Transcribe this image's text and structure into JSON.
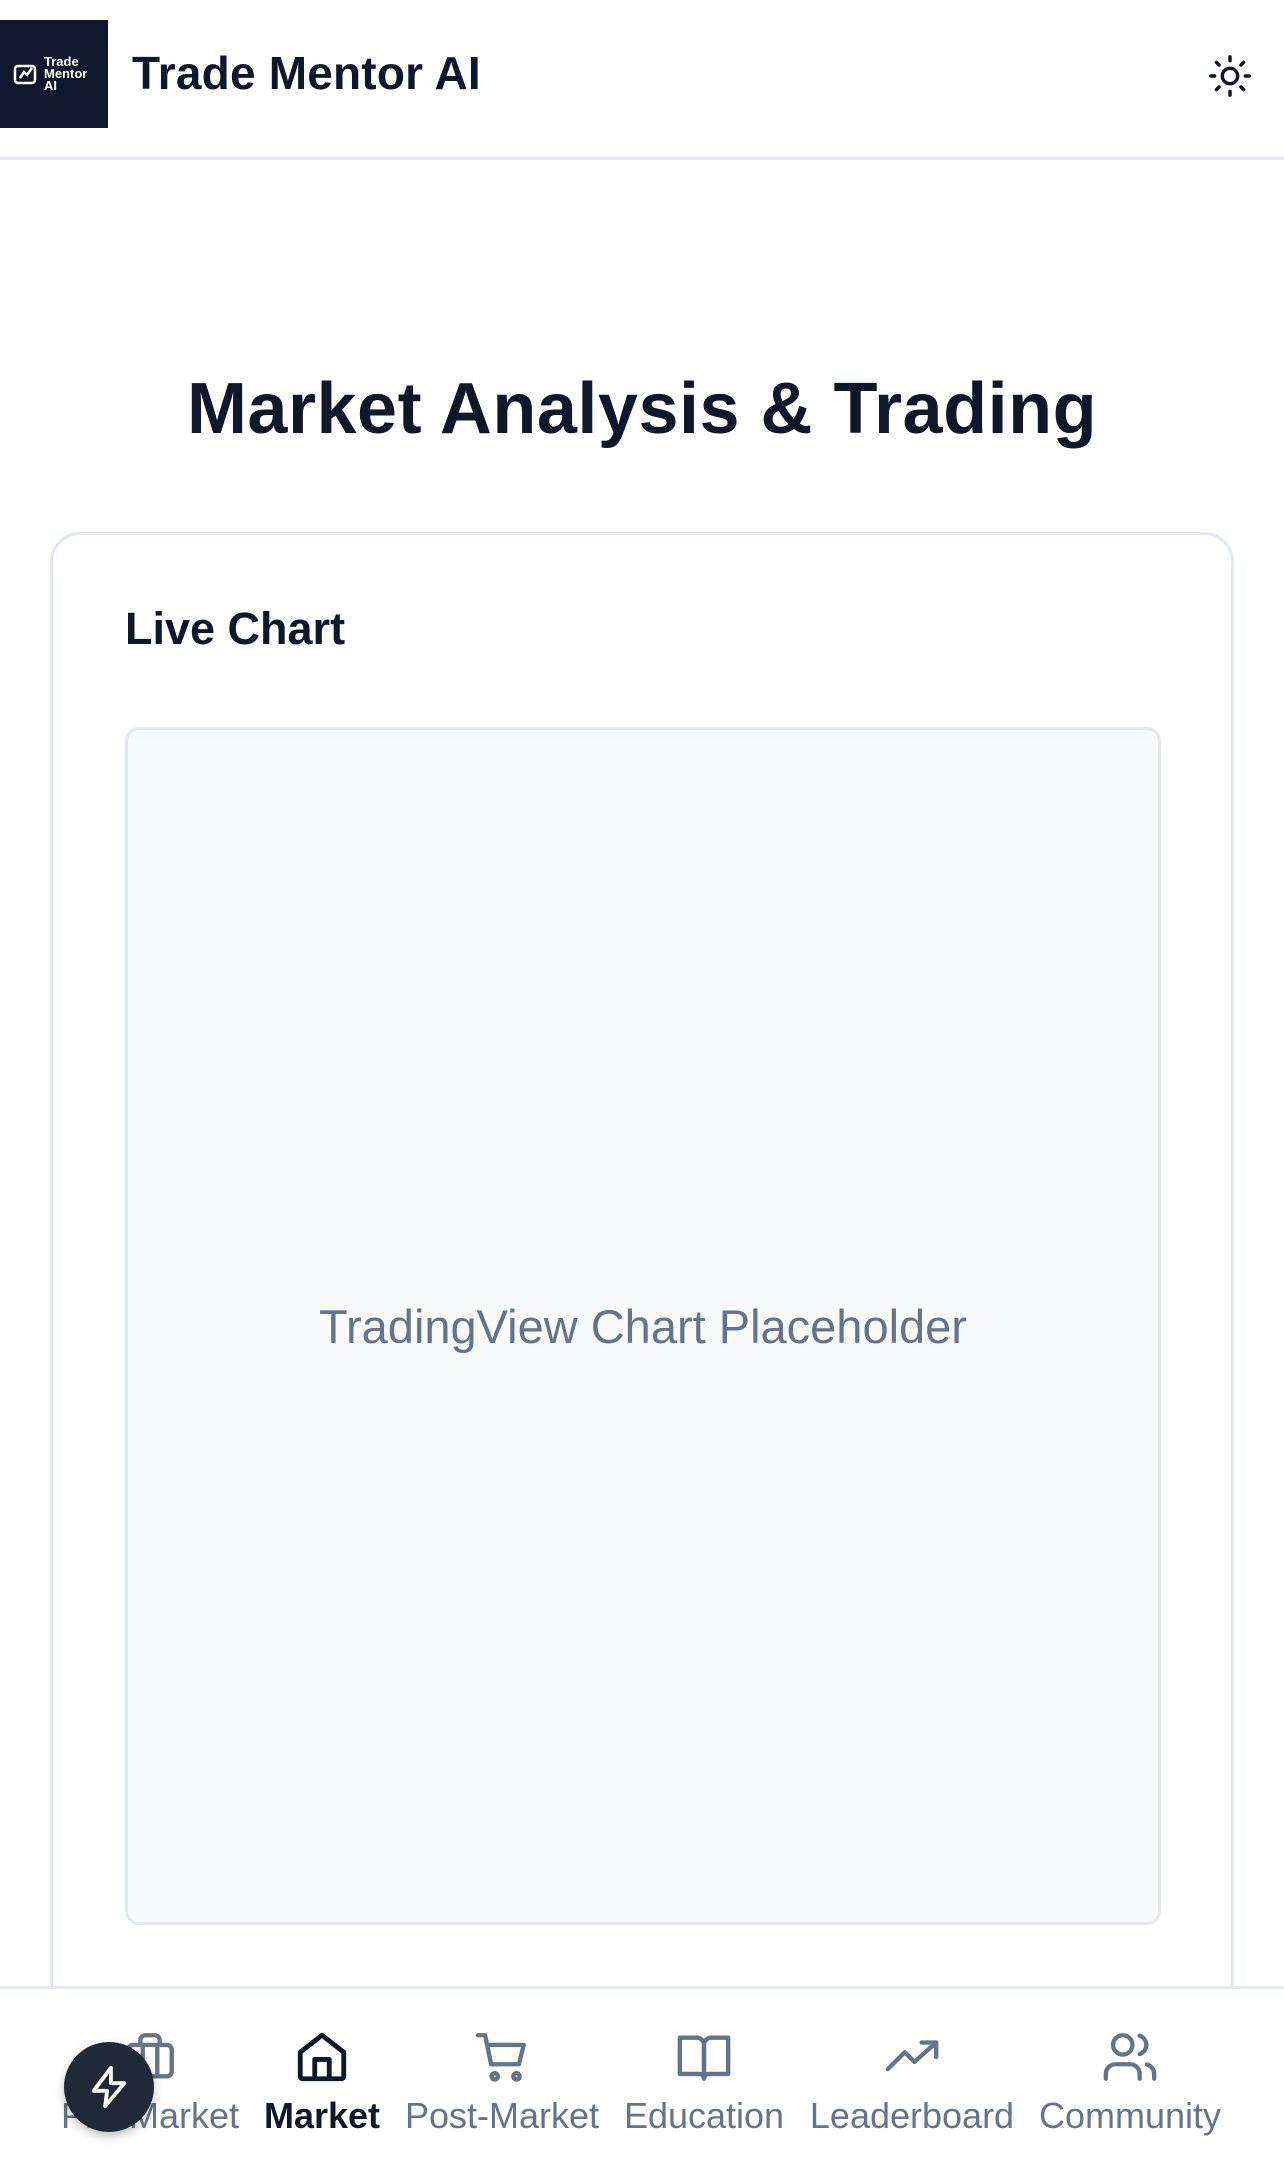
{
  "header": {
    "logo_text": "Trade Mentor AI",
    "app_title": "Trade Mentor AI",
    "theme_toggle_icon": "sun-icon"
  },
  "main": {
    "page_title": "Market Analysis & Trading",
    "card": {
      "title": "Live Chart",
      "chart_placeholder": "TradingView Chart Placeholder"
    }
  },
  "bottom_nav": {
    "items": [
      {
        "label": "Pre-Market",
        "icon": "briefcase-icon",
        "active": false
      },
      {
        "label": "Market",
        "icon": "home-icon",
        "active": true
      },
      {
        "label": "Post-Market",
        "icon": "shopping-cart-icon",
        "active": false
      },
      {
        "label": "Education",
        "icon": "book-open-icon",
        "active": false
      },
      {
        "label": "Leaderboard",
        "icon": "trending-up-icon",
        "active": false
      },
      {
        "label": "Community",
        "icon": "users-icon",
        "active": false
      }
    ]
  },
  "fab": {
    "icon": "lightning-icon"
  },
  "colors": {
    "brand_dark": "#0f172a",
    "muted_text": "#64748b",
    "border": "#e2e8f0",
    "chart_bg": "#f8fafc"
  }
}
